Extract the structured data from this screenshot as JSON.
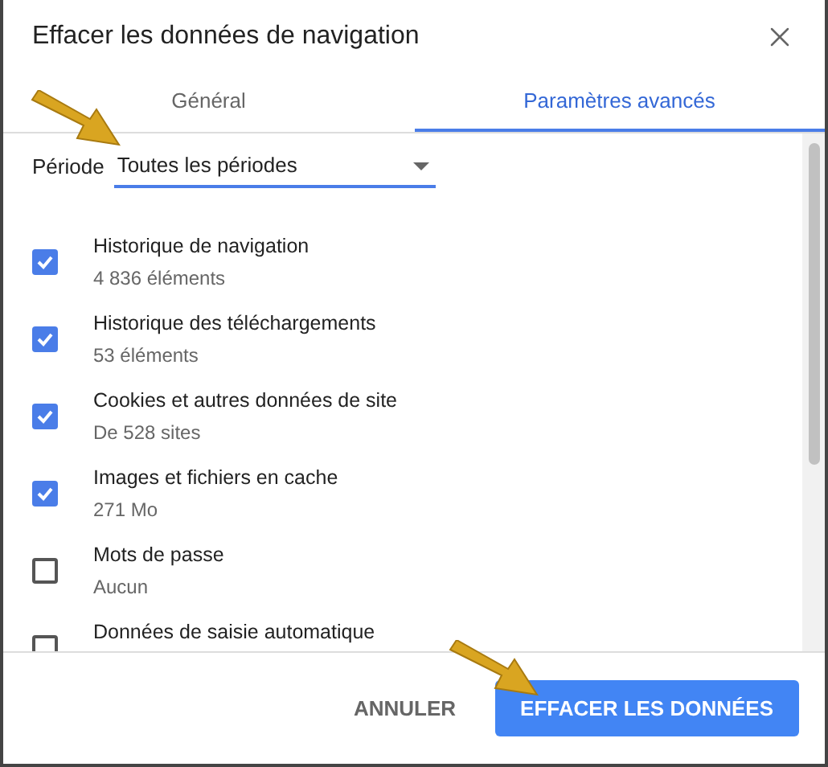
{
  "dialog": {
    "title": "Effacer les données de navigation"
  },
  "tabs": [
    {
      "label": "Général",
      "selected": false
    },
    {
      "label": "Paramètres avancés",
      "selected": true
    }
  ],
  "period": {
    "label": "Période",
    "value": "Toutes les périodes"
  },
  "items": [
    {
      "label": "Historique de navigation",
      "detail": "4 836 éléments",
      "checked": true
    },
    {
      "label": "Historique des téléchargements",
      "detail": "53 éléments",
      "checked": true
    },
    {
      "label": "Cookies et autres données de site",
      "detail": "De 528 sites",
      "checked": true
    },
    {
      "label": "Images et fichiers en cache",
      "detail": "271 Mo",
      "checked": true
    },
    {
      "label": "Mots de passe",
      "detail": "Aucun",
      "checked": false
    },
    {
      "label": "Données de saisie automatique",
      "checked": false
    }
  ],
  "buttons": {
    "cancel": "ANNULER",
    "confirm": "EFFACER LES DONNÉES"
  }
}
